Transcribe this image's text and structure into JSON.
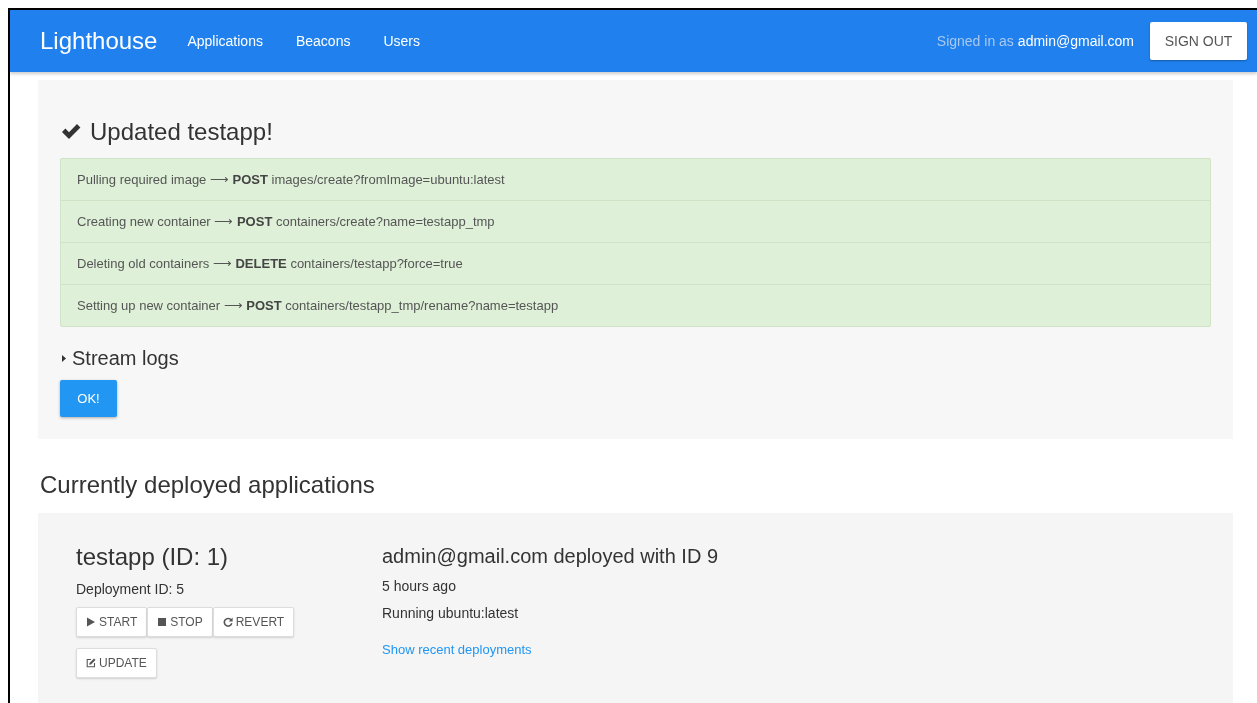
{
  "navbar": {
    "brand": "Lighthouse",
    "links": [
      {
        "label": "Applications"
      },
      {
        "label": "Beacons"
      },
      {
        "label": "Users"
      }
    ],
    "signed_in_label": "Signed in as",
    "user": "admin@gmail.com",
    "sign_out": "SIGN OUT"
  },
  "update_panel": {
    "title": "Updated testapp!",
    "steps": [
      {
        "text": "Pulling required image ⟶ **POST** images/create?fromImage=ubuntu:latest"
      },
      {
        "text": "Creating new container ⟶ **POST** containers/create?name=testapp_tmp"
      },
      {
        "text": "Deleting old containers ⟶ **DELETE** containers/testapp?force=true"
      },
      {
        "text": "Setting up new container ⟶ **POST** containers/testapp_tmp/rename?name=testapp"
      }
    ],
    "stream_logs": {
      "label": "Stream logs",
      "expanded": false
    },
    "ok_button": "OK!"
  },
  "deployed": {
    "heading": "Currently deployed applications",
    "apps": [
      {
        "name": "testapp (ID: 1)",
        "deployment": "Deployment ID: 5",
        "actions": [
          {
            "kind": "play",
            "label": "START"
          },
          {
            "kind": "stop",
            "label": "STOP"
          },
          {
            "kind": "refresh",
            "label": "REVERT"
          }
        ],
        "update": "UPDATE",
        "summary": "admin@gmail.com deployed with ID 9",
        "time": "5 hours ago",
        "running": "Running ubuntu:latest",
        "link": "Show recent deployments"
      }
    ]
  }
}
